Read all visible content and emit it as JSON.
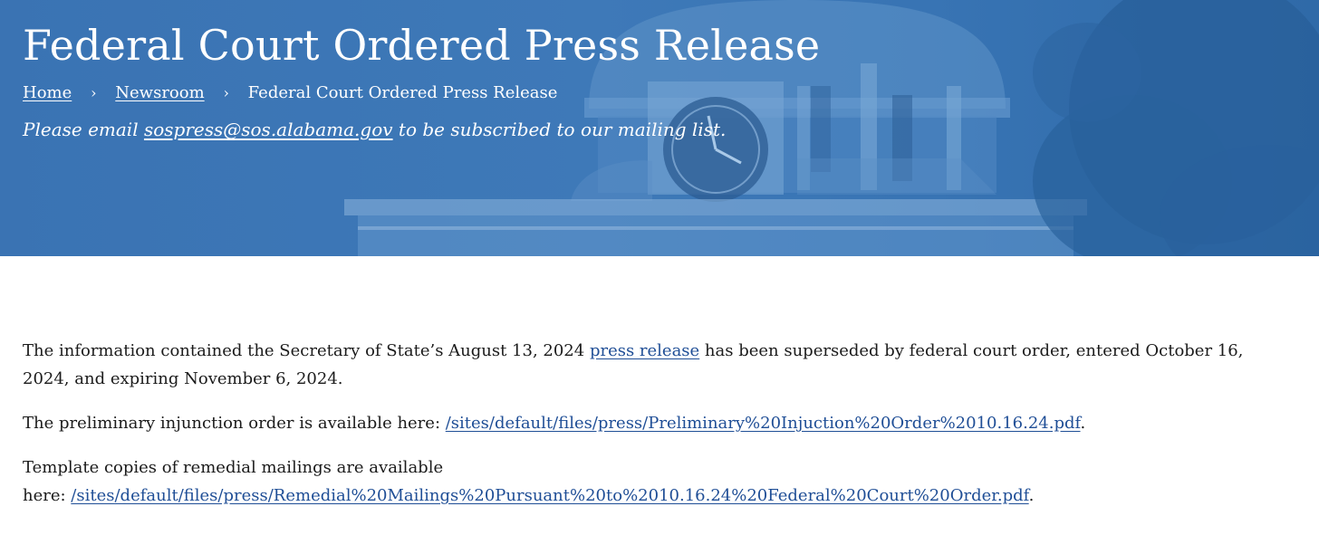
{
  "header": {
    "title": "Federal Court Ordered Press Release",
    "breadcrumb": {
      "home": "Home",
      "separator": "›",
      "newsroom": "Newsroom",
      "current": "Federal Court Ordered Press Release"
    },
    "mailing": {
      "prefix": "Please email ",
      "email": "sospress@sos.alabama.gov",
      "suffix": " to be subscribed to our mailing list."
    }
  },
  "body": {
    "p1": {
      "before": "The information contained the Secretary of State’s August 13, 2024 ",
      "link": "press release",
      "after": " has been superseded by federal court order, entered October 16, 2024, and expiring November 6, 2024."
    },
    "p2": {
      "before": "The preliminary injunction order is available here: ",
      "link": "/sites/default/files/press/Preliminary%20Injuction%20Order%2010.16.24.pdf",
      "after": "."
    },
    "p3": {
      "line1": "Template copies of remedial mailings are available",
      "before": "here: ",
      "link": "/sites/default/files/press/Remedial%20Mailings%20Pursuant%20to%2010.16.24%20Federal%20Court%20Order.pdf",
      "after": "."
    }
  },
  "colors": {
    "hero_blue": "#3a73b3",
    "link_blue": "#1f4e96",
    "text": "#1b1b1b"
  }
}
